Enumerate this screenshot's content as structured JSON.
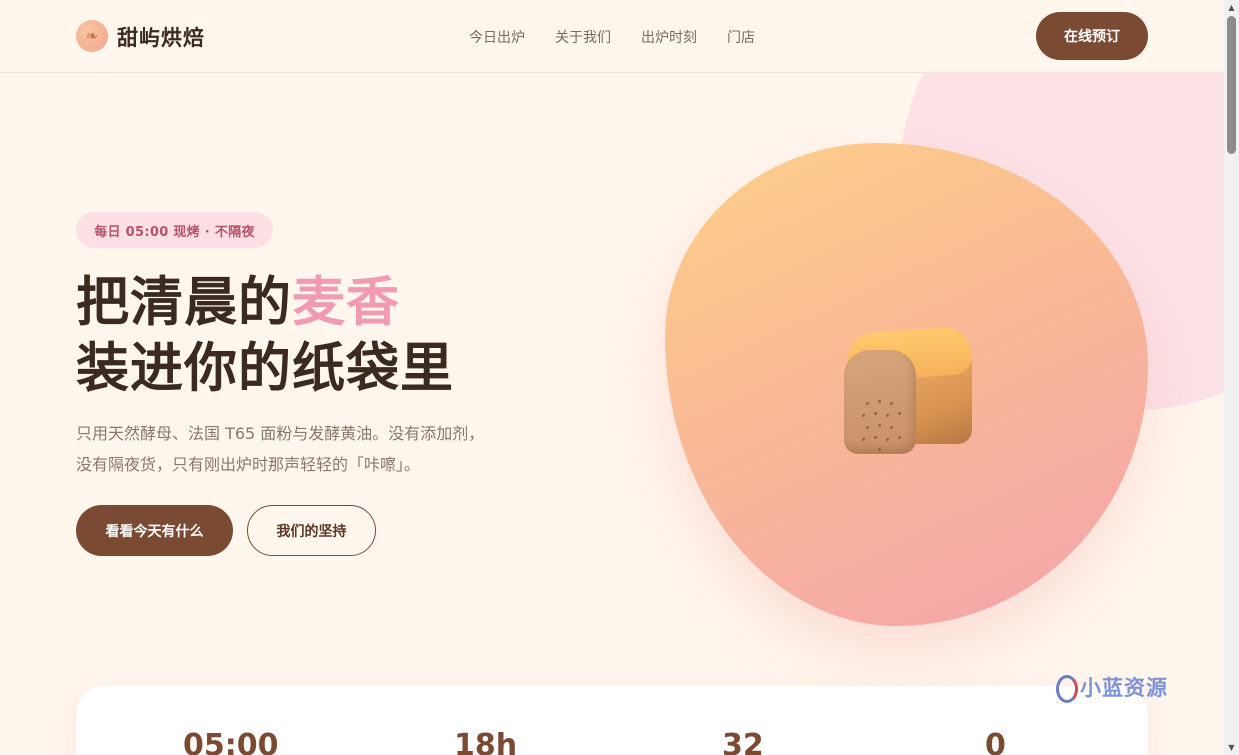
{
  "header": {
    "brand": "甜屿烘焙",
    "nav": [
      "今日出炉",
      "关于我们",
      "出炉时刻",
      "门店"
    ],
    "cta": "在线预订"
  },
  "hero": {
    "badge": "每日 05:00 现烤 · 不隔夜",
    "headline_line1_prefix": "把清晨的",
    "headline_line1_accent": "麦香",
    "headline_line2": "装进你的纸袋里",
    "desc_line1": "只用天然酵母、法国 T65 面粉与发酵黄油。没有添加剂，",
    "desc_line2": "没有隔夜货，只有刚出炉时那声轻轻的「咔嚓」。",
    "primary_button": "看看今天有什么",
    "secondary_button": "我们的坚持"
  },
  "stats": [
    "05:00",
    "18h",
    "32",
    "0"
  ],
  "watermark": "小蓝资源",
  "colors": {
    "background": "#fff6ee",
    "brand_brown": "#7a4a33",
    "accent_pink": "#f19ab1",
    "blob_start": "#fdd089",
    "blob_end": "#f4a4ad"
  },
  "icons": {
    "logo": "croissant-icon",
    "illustration": "bread-loaf-icon"
  }
}
